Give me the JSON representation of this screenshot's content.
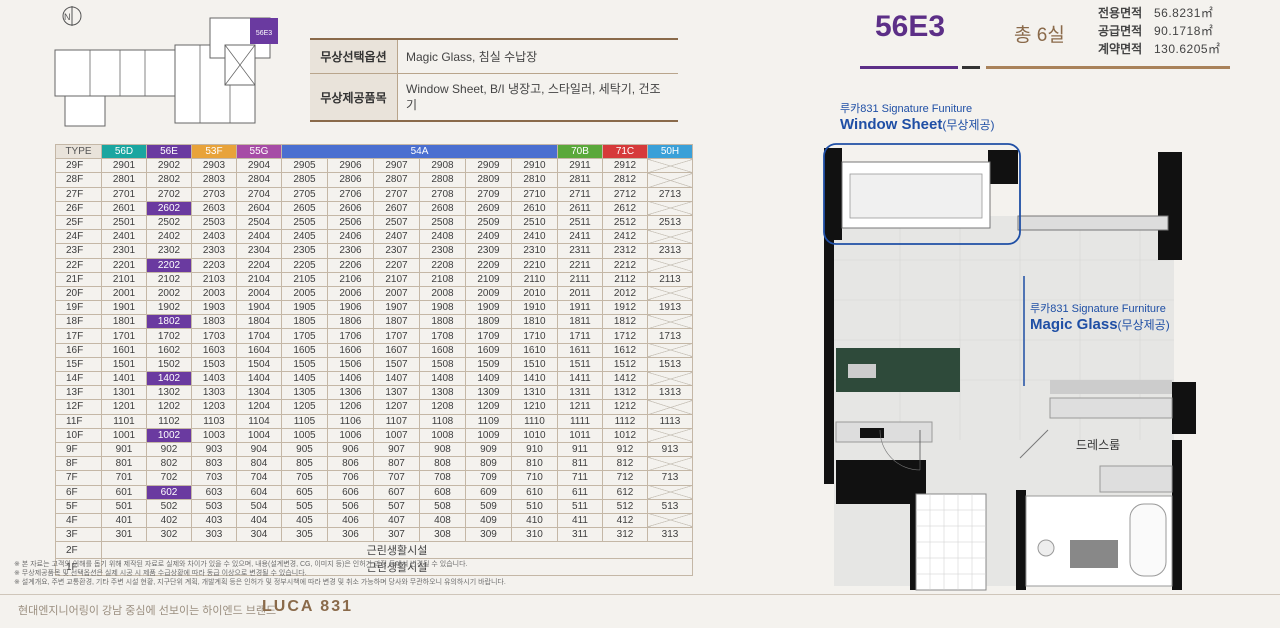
{
  "options": [
    {
      "label": "무상선택옵션",
      "value": "Magic Glass, 침실 수납장"
    },
    {
      "label": "무상제공품목",
      "value": "Window Sheet, B/I 냉장고, 스타일러, 세탁기, 건조기"
    }
  ],
  "keyplan": {
    "unit_label": "56E3",
    "highlight_color": "#6a3aa0"
  },
  "unit": {
    "type": "56E3",
    "count": "총 6실",
    "areas": [
      {
        "label": "전용면적",
        "value": "56.8231㎡"
      },
      {
        "label": "공급면적",
        "value": "90.1718㎡"
      },
      {
        "label": "계약면적",
        "value": "130.6205㎡"
      }
    ]
  },
  "signatures": {
    "window": {
      "sub": "루카831 Signature Funiture",
      "main": "Window Sheet",
      "tag": "(무상제공)"
    },
    "glass": {
      "sub": "루카831 Signature Furniture",
      "main": "Magic Glass",
      "tag": "(무상제공)"
    }
  },
  "room_label": "드레스룸",
  "table": {
    "type_label": "TYPE",
    "headers": [
      {
        "label": "56D",
        "color": "#1aa6a0",
        "span": 1
      },
      {
        "label": "56E",
        "color": "#6a3aa0",
        "span": 1
      },
      {
        "label": "53F",
        "color": "#e8a33a",
        "span": 1
      },
      {
        "label": "55G",
        "color": "#a64ca6",
        "span": 1
      },
      {
        "label": "54A",
        "color": "#4a6fd0",
        "span": 6
      },
      {
        "label": "70B",
        "color": "#5aa83a",
        "span": 1
      },
      {
        "label": "71C",
        "color": "#d63a3a",
        "span": 1
      },
      {
        "label": "50H",
        "color": "#3aa0d8",
        "span": 1
      }
    ],
    "rows": [
      {
        "floor": "29F",
        "cells": [
          "2901",
          "2902",
          "2903",
          "2904",
          "2905",
          "2906",
          "2907",
          "2908",
          "2909",
          "2910",
          "2911",
          "2912",
          ""
        ]
      },
      {
        "floor": "28F",
        "cells": [
          "2801",
          "2802",
          "2803",
          "2804",
          "2805",
          "2806",
          "2807",
          "2808",
          "2809",
          "2810",
          "2811",
          "2812",
          ""
        ]
      },
      {
        "floor": "27F",
        "cells": [
          "2701",
          "2702",
          "2703",
          "2704",
          "2705",
          "2706",
          "2707",
          "2708",
          "2709",
          "2710",
          "2711",
          "2712",
          "2713"
        ]
      },
      {
        "floor": "26F",
        "cells": [
          "2601",
          "2602",
          "2603",
          "2604",
          "2605",
          "2606",
          "2607",
          "2608",
          "2609",
          "2610",
          "2611",
          "2612",
          ""
        ],
        "hl": 1
      },
      {
        "floor": "25F",
        "cells": [
          "2501",
          "2502",
          "2503",
          "2504",
          "2505",
          "2506",
          "2507",
          "2508",
          "2509",
          "2510",
          "2511",
          "2512",
          "2513"
        ]
      },
      {
        "floor": "24F",
        "cells": [
          "2401",
          "2402",
          "2403",
          "2404",
          "2405",
          "2406",
          "2407",
          "2408",
          "2409",
          "2410",
          "2411",
          "2412",
          ""
        ]
      },
      {
        "floor": "23F",
        "cells": [
          "2301",
          "2302",
          "2303",
          "2304",
          "2305",
          "2306",
          "2307",
          "2308",
          "2309",
          "2310",
          "2311",
          "2312",
          "2313"
        ]
      },
      {
        "floor": "22F",
        "cells": [
          "2201",
          "2202",
          "2203",
          "2204",
          "2205",
          "2206",
          "2207",
          "2208",
          "2209",
          "2210",
          "2211",
          "2212",
          ""
        ],
        "hl": 1
      },
      {
        "floor": "21F",
        "cells": [
          "2101",
          "2102",
          "2103",
          "2104",
          "2105",
          "2106",
          "2107",
          "2108",
          "2109",
          "2110",
          "2111",
          "2112",
          "2113"
        ]
      },
      {
        "floor": "20F",
        "cells": [
          "2001",
          "2002",
          "2003",
          "2004",
          "2005",
          "2006",
          "2007",
          "2008",
          "2009",
          "2010",
          "2011",
          "2012",
          ""
        ]
      },
      {
        "floor": "19F",
        "cells": [
          "1901",
          "1902",
          "1903",
          "1904",
          "1905",
          "1906",
          "1907",
          "1908",
          "1909",
          "1910",
          "1911",
          "1912",
          "1913"
        ]
      },
      {
        "floor": "18F",
        "cells": [
          "1801",
          "1802",
          "1803",
          "1804",
          "1805",
          "1806",
          "1807",
          "1808",
          "1809",
          "1810",
          "1811",
          "1812",
          ""
        ],
        "hl": 1
      },
      {
        "floor": "17F",
        "cells": [
          "1701",
          "1702",
          "1703",
          "1704",
          "1705",
          "1706",
          "1707",
          "1708",
          "1709",
          "1710",
          "1711",
          "1712",
          "1713"
        ]
      },
      {
        "floor": "16F",
        "cells": [
          "1601",
          "1602",
          "1603",
          "1604",
          "1605",
          "1606",
          "1607",
          "1608",
          "1609",
          "1610",
          "1611",
          "1612",
          ""
        ]
      },
      {
        "floor": "15F",
        "cells": [
          "1501",
          "1502",
          "1503",
          "1504",
          "1505",
          "1506",
          "1507",
          "1508",
          "1509",
          "1510",
          "1511",
          "1512",
          "1513"
        ]
      },
      {
        "floor": "14F",
        "cells": [
          "1401",
          "1402",
          "1403",
          "1404",
          "1405",
          "1406",
          "1407",
          "1408",
          "1409",
          "1410",
          "1411",
          "1412",
          ""
        ],
        "hl": 1
      },
      {
        "floor": "13F",
        "cells": [
          "1301",
          "1302",
          "1303",
          "1304",
          "1305",
          "1306",
          "1307",
          "1308",
          "1309",
          "1310",
          "1311",
          "1312",
          "1313"
        ]
      },
      {
        "floor": "12F",
        "cells": [
          "1201",
          "1202",
          "1203",
          "1204",
          "1205",
          "1206",
          "1207",
          "1208",
          "1209",
          "1210",
          "1211",
          "1212",
          ""
        ]
      },
      {
        "floor": "11F",
        "cells": [
          "1101",
          "1102",
          "1103",
          "1104",
          "1105",
          "1106",
          "1107",
          "1108",
          "1109",
          "1110",
          "1111",
          "1112",
          "1113"
        ]
      },
      {
        "floor": "10F",
        "cells": [
          "1001",
          "1002",
          "1003",
          "1004",
          "1005",
          "1006",
          "1007",
          "1008",
          "1009",
          "1010",
          "1011",
          "1012",
          ""
        ],
        "hl": 1
      },
      {
        "floor": "9F",
        "cells": [
          "901",
          "902",
          "903",
          "904",
          "905",
          "906",
          "907",
          "908",
          "909",
          "910",
          "911",
          "912",
          "913"
        ]
      },
      {
        "floor": "8F",
        "cells": [
          "801",
          "802",
          "803",
          "804",
          "805",
          "806",
          "807",
          "808",
          "809",
          "810",
          "811",
          "812",
          ""
        ]
      },
      {
        "floor": "7F",
        "cells": [
          "701",
          "702",
          "703",
          "704",
          "705",
          "706",
          "707",
          "708",
          "709",
          "710",
          "711",
          "712",
          "713"
        ]
      },
      {
        "floor": "6F",
        "cells": [
          "601",
          "602",
          "603",
          "604",
          "605",
          "606",
          "607",
          "608",
          "609",
          "610",
          "611",
          "612",
          ""
        ],
        "hl": 1
      },
      {
        "floor": "5F",
        "cells": [
          "501",
          "502",
          "503",
          "504",
          "505",
          "506",
          "507",
          "508",
          "509",
          "510",
          "511",
          "512",
          "513"
        ]
      },
      {
        "floor": "4F",
        "cells": [
          "401",
          "402",
          "403",
          "404",
          "405",
          "406",
          "407",
          "408",
          "409",
          "410",
          "411",
          "412",
          ""
        ]
      },
      {
        "floor": "3F",
        "cells": [
          "301",
          "302",
          "303",
          "304",
          "305",
          "306",
          "307",
          "308",
          "309",
          "310",
          "311",
          "312",
          "313"
        ]
      }
    ],
    "facility_rows": [
      {
        "floor": "2F",
        "label": "근린생활시설"
      },
      {
        "floor": "1F",
        "label": "근린생활시설"
      }
    ]
  },
  "notes": [
    "※ 본 자료는 고객의 이해를 돕기 위해 제작된 자료로 실제와 차이가 있을 수 있으며, 내용(설계변경, CG, 이미지 등)은 인허가 과정 등에서 변경될 수 있습니다.",
    "※ 무상제공품목 및 선택옵션은 실제 시공 시 제품 수급상황에 따라 동급 이상으로 변경될 수 있습니다.",
    "※ 설계개요, 주변 교통환경, 기타 주변 시설 현황, 지구단위 계획, 개발계획 등은 인허가 및 정부시책에 따라 변경 및 취소 가능하며 당사와 무관하오니 유의하시기 바랍니다."
  ],
  "footer": {
    "slogan": "현대엔지니어링이 강남 중심에 선보이는 하이엔드 브랜드",
    "brand": "LUCA 831"
  }
}
